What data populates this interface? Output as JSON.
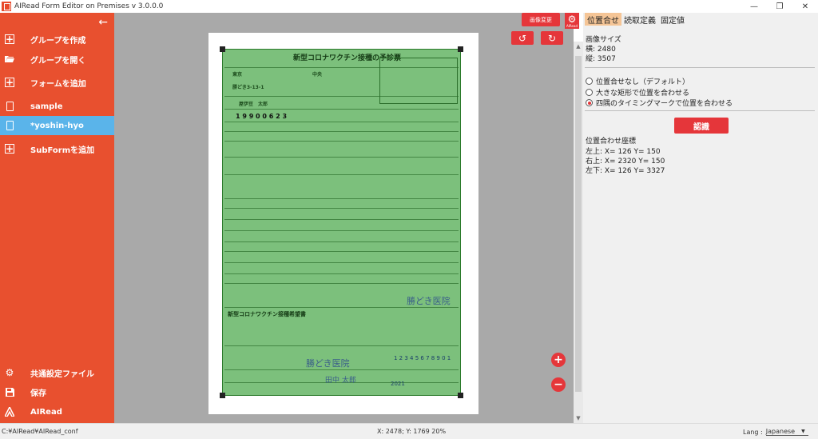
{
  "window": {
    "title": "AIRead Form Editor on Premises v 3.0.0.0",
    "controls": {
      "minimize": "—",
      "maximize": "❐",
      "close": "✕"
    }
  },
  "sidebar": {
    "back_icon": "←",
    "top_items": [
      {
        "label": "グループを作成",
        "icon": "add-box-icon"
      },
      {
        "label": "グループを開く",
        "icon": "folder-open-icon"
      },
      {
        "label": "フォームを追加",
        "icon": "add-box-icon"
      },
      {
        "label": "sample",
        "icon": "document-icon"
      },
      {
        "label": "*yoshin-hyo",
        "icon": "document-icon",
        "active": true
      },
      {
        "label": "SubFormを追加",
        "icon": "add-box-icon"
      }
    ],
    "bottom_items": [
      {
        "label": "共通設定ファイル",
        "icon": "gear-icon"
      },
      {
        "label": "保存",
        "icon": "save-icon"
      },
      {
        "label": "AIRead",
        "icon": "airead-logo-icon"
      }
    ]
  },
  "toolbar": {
    "image_change_label": "画像変更",
    "gear_caption": "AIRead",
    "rotate_left_icon": "↺",
    "rotate_right_icon": "↻",
    "zoom_in_icon": "+",
    "zoom_out_icon": "−"
  },
  "document": {
    "title": "新型コロナワクチン接種の予診票",
    "address": "東京",
    "ward": "中央",
    "street": "勝どき3-13-1",
    "name": "屋伊豆　太郎",
    "birth": "1 9 9 0 0 6 2 3",
    "section2": "新型コロナワクチン接種希望書",
    "clinic_stamp": "勝どき医院",
    "doctor": "田中 太郎",
    "date_2021": "2021",
    "serial": "1 2 3 4 5 6 7 8 9 0 1"
  },
  "right_panel": {
    "tabs": [
      "位置合せ",
      "読取定義",
      "固定値"
    ],
    "active_tab": 0,
    "image_size_label": "画像サイズ",
    "width_line": "横: 2480",
    "height_line": "縦: 3507",
    "radio_options": [
      {
        "label": "位置合せなし（デフォルト）",
        "checked": false
      },
      {
        "label": "大きな矩形で位置を合わせる",
        "checked": false
      },
      {
        "label": "四隅のタイミングマークで位置を合わせる",
        "checked": true
      }
    ],
    "recognize_button": "認識",
    "coord_title": "位置合わせ座標",
    "coords": [
      "左上: X= 126   Y= 150",
      "右上: X= 2320   Y= 150",
      "左下: X= 126   Y= 3327"
    ]
  },
  "status": {
    "path": "C:¥AIRead¥AIRead_conf",
    "cursor": "X: 2478; Y: 1769  20%",
    "lang_label": "Lang :",
    "lang_value": "Japanese"
  },
  "colors": {
    "sidebar": "#e8502f",
    "active_item": "#5ab4ea",
    "accent_red": "#e5363a",
    "overlay_green": "#7cc07c",
    "active_tab": "#f5c596"
  }
}
